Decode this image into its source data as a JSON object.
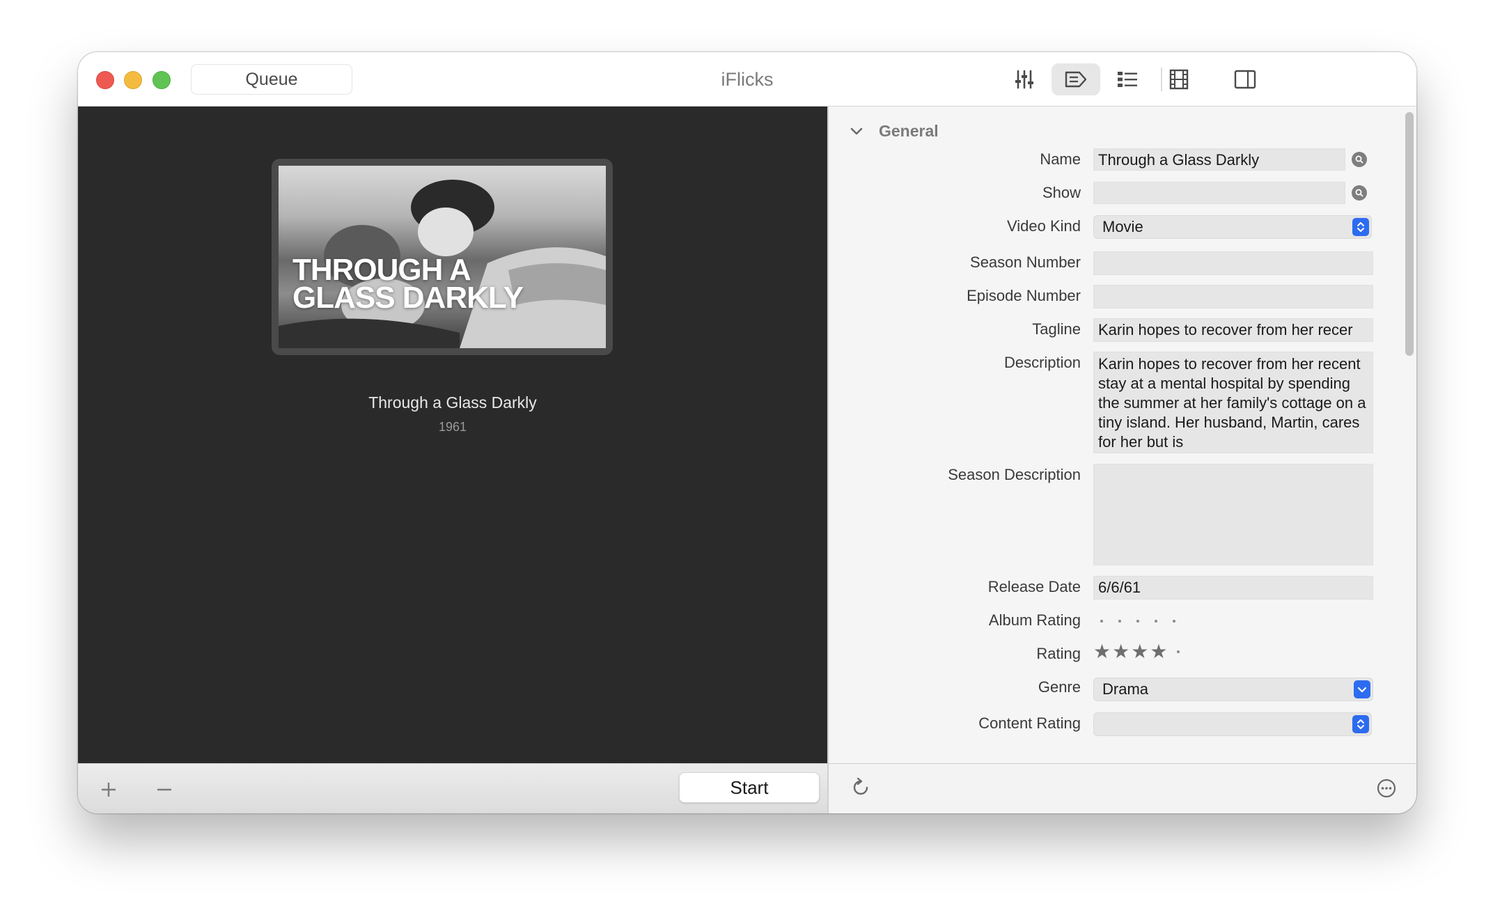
{
  "window": {
    "title": "iFlicks",
    "queue_label": "Queue",
    "toolbar": [
      "sliders-icon",
      "tag-icon",
      "list-icon",
      "film-strip-icon",
      "sidebar-icon"
    ]
  },
  "queue_item": {
    "poster_text_line1": "THROUGH A",
    "poster_text_line2": "GLASS DARKLY",
    "title": "Through a Glass Darkly",
    "year": "1961"
  },
  "bottom_bar": {
    "start_label": "Start"
  },
  "inspector": {
    "section": "General",
    "labels": {
      "name": "Name",
      "show": "Show",
      "video_kind": "Video Kind",
      "season_number": "Season Number",
      "episode_number": "Episode Number",
      "tagline": "Tagline",
      "description": "Description",
      "season_description": "Season Description",
      "release_date": "Release Date",
      "album_rating": "Album Rating",
      "rating": "Rating",
      "genre": "Genre",
      "content_rating": "Content Rating"
    },
    "values": {
      "name": "Through a Glass Darkly",
      "show": "",
      "video_kind": "Movie",
      "season_number": "",
      "episode_number": "",
      "tagline": "Karin hopes to recover from her recer",
      "description": "Karin hopes to recover from her recent stay at a mental hospital by spending the summer at her family's cottage on a tiny island. Her husband, Martin, cares for her but is",
      "season_description": "",
      "release_date": "6/6/61",
      "album_rating": 0,
      "rating": 4,
      "rating_max": 5,
      "genre": "Drama",
      "content_rating": ""
    }
  }
}
